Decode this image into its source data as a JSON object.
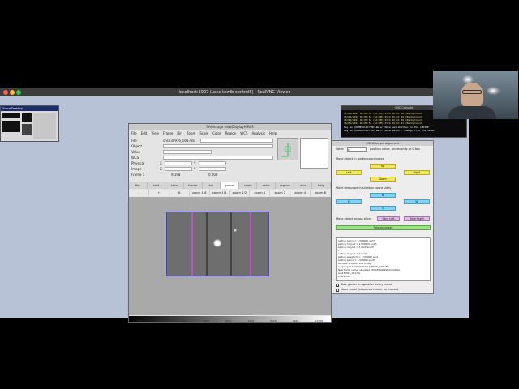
{
  "vnc": {
    "title": "localhost:5907 (ucsc-kcwib-control6) - RealVNC Viewer"
  },
  "x_desktop": {
    "title": "XcoveDesktop"
  },
  "ds9": {
    "title": "SAOImage hsfwDisplayHSWS",
    "menu": [
      "File",
      "Edit",
      "View",
      "Frame",
      "Bin",
      "Zoom",
      "Scale",
      "Color",
      "Region",
      "WCS",
      "Analysis",
      "Help"
    ],
    "info": {
      "file_label": "File",
      "file_value": "sns230916_00178s",
      "object_label": "Object",
      "value_label": "Value",
      "wcs_label": "WCS",
      "physical_label": "Physical",
      "image_label": "Image",
      "frame_label": "Frame 1",
      "x_label": "X",
      "y_label": "Y",
      "zoom_value": "9.198",
      "angle_value": "0.000"
    },
    "buttons": [
      "file",
      "edit",
      "view",
      "frame",
      "bin",
      "zoom",
      "scale",
      "color",
      "region",
      "wcs",
      "help"
    ],
    "active_button": "zoom",
    "zoom_buttons": [
      "-",
      "+",
      "fit",
      "zoom 1/8",
      "zoom 1/4",
      "zoom 1/2",
      "zoom 1",
      "zoom 2",
      "zoom 4",
      "zoom 8"
    ],
    "colorbar_ticks": [
      "137",
      "1765",
      "3114",
      "4486",
      "5830",
      "7216",
      "8576",
      "9948",
      "11318"
    ]
  },
  "console": {
    "title": "VNC Console",
    "lines": [
      "16/09/2023 08:09:52 (AC:MM) Pick Point 18 (Background)",
      "16/09/2023 08:09:52 (AC:MM) Pick Point 19 (Background)",
      "16/09/2023 08:09:52 (AC:MM) Pick Point 20 (Background)",
      "16/09/2023 08:09:53 (AC:MM) Pick Point 21 (Background)",
      "Hay es (DUMB)KCWC?VNC Note: Note was Written to the CHOICE",
      "Hay es (DUMB)KCWC?VNC Wait: Note saved - change file the SENSE"
    ]
  },
  "hsfw": {
    "title": "HSFW target alignment",
    "value_label": "Value",
    "value": "1",
    "value_hint": "position value, arcseconds or 0 box",
    "move_guider_label": "Move object in guider coordinates",
    "move_slicer_label": "Move telescope in slicebox coord sides",
    "up": "Up",
    "left": "Left",
    "right": "Right",
    "down": "Down",
    "n": "N",
    "e": "E",
    "w": "W",
    "s": "S",
    "slicer_row_label": "Move object across slicer",
    "slice_left": "Slice Left",
    "slice_right": "Slice Right",
    "take_image": "Take an image",
    "log": [
      "setting period = 1.500000 north",
      "setting magnet = 1.500000 south",
      "setting magnet = 1 (def) south",
      "1",
      "setting magnet = 4 (east)",
      "setting waveform = 1.500000 east",
      "setting period = 1.500000 south",
      "success: acquired slot contai",
      "outgoing ELK/CSWOpDimageHSWS_0004.fits",
      "New frame name: uploaded kdWAFWKDNSNQuickDisp",
      "sns230916_00178s",
      "HSWS file"
    ],
    "chk1": "Take guider image after every move",
    "chk2": "Move mode (show command, no moves)"
  }
}
